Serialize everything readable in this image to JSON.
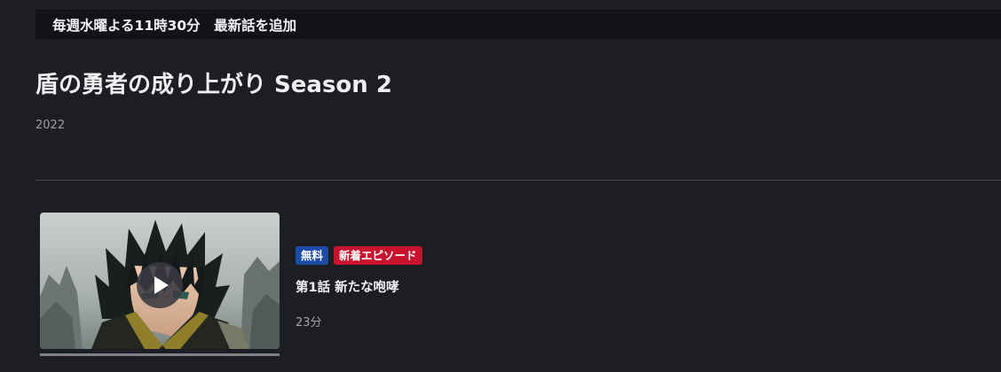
{
  "notice": {
    "text": "毎週水曜よる11時30分　最新話を追加"
  },
  "series": {
    "title": "盾の勇者の成り上がり Season 2",
    "year": "2022"
  },
  "episodes": [
    {
      "badges": [
        {
          "label": "無料",
          "color": "#1c4ba8"
        },
        {
          "label": "新着エピソード",
          "color": "#c8122e"
        }
      ],
      "title": "第1話 新たな咆哮",
      "duration": "23分",
      "thumbnail_icon": "anime-character-thumbnail",
      "play_icon": "play-icon"
    }
  ]
}
